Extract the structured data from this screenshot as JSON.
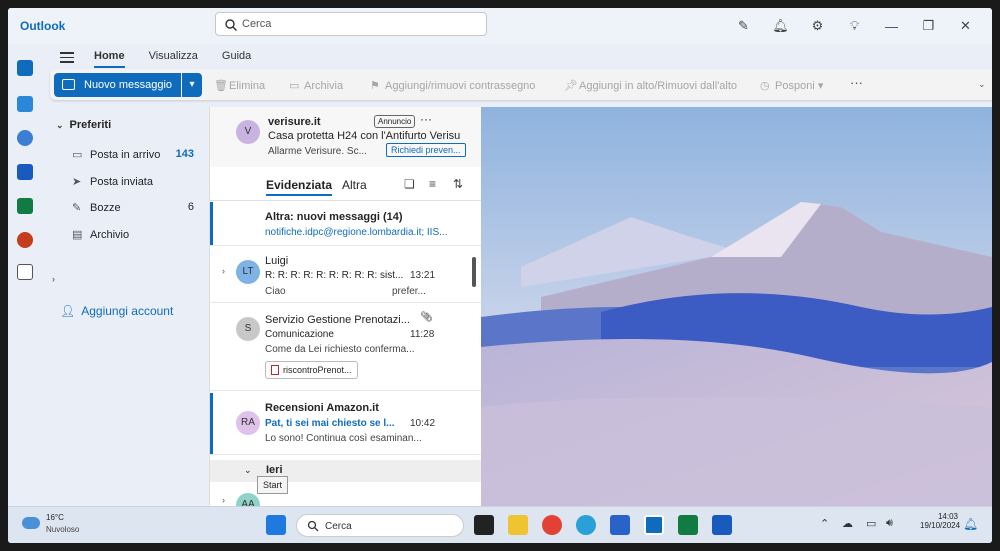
{
  "app": {
    "title": "Outlook"
  },
  "search": {
    "placeholder": "Cerca"
  },
  "titlebar_icons": [
    "compose-note-icon",
    "bell-icon",
    "gear-icon",
    "lightbulb-icon",
    "minimize-icon",
    "restore-icon",
    "close-icon"
  ],
  "tabs": [
    {
      "label": "Home",
      "active": true
    },
    {
      "label": "Visualizza",
      "active": false
    },
    {
      "label": "Guida",
      "active": false
    }
  ],
  "ribbon": {
    "new_message": "Nuovo messaggio",
    "delete": "Elimina",
    "archive": "Archivia",
    "flag": "Aggiungi/rimuovi contrassegno",
    "pin": "Aggiungi in alto/Rimuovi dall'alto",
    "snooze": "Posponi",
    "more": "···"
  },
  "folders": {
    "header": "Preferiti",
    "items": [
      {
        "label": "Posta in arrivo",
        "count": "143",
        "icon": "inbox-icon"
      },
      {
        "label": "Posta inviata",
        "count": "",
        "icon": "send-icon"
      },
      {
        "label": "Bozze",
        "count": "6",
        "icon": "pencil-icon"
      },
      {
        "label": "Archivio",
        "count": "",
        "icon": "archive-icon"
      }
    ],
    "add_account": "Aggiungi account"
  },
  "ad": {
    "avatar": "V",
    "sender": "verisure.it",
    "badge": "Annuncio",
    "subject": "Casa protetta H24 con l'Antifurto Verisu",
    "preview": "Allarme Verisure. Sc...",
    "cta": "Richiedi preven..."
  },
  "list_tabs": {
    "focused": "Evidenziata",
    "other": "Altra"
  },
  "other_banner": {
    "title": "Altra: nuovi messaggi (14)",
    "senders": "notifiche.idpc@regione.lombardia.it; IIS..."
  },
  "messages": [
    {
      "avatar": "LT",
      "from": "Luigi",
      "subject": "R: R: R: R: R: R: R: R: R: sist...",
      "time": "13:21",
      "preview_start": "Ciao",
      "preview_end": "prefer..."
    },
    {
      "avatar": "S",
      "from": "Servizio Gestione Prenotazi...",
      "subject": "Comunicazione",
      "time": "11:28",
      "preview": "Come da Lei richiesto conferma...",
      "attachment": "riscontroPrenot..."
    },
    {
      "avatar": "RA",
      "from": "Recensioni Amazon.it",
      "subject": "Pat, ti sei mai chiesto se l...",
      "time": "10:42",
      "preview": "Lo sono! Continua così esaminan..."
    }
  ],
  "group": {
    "label": "Ieri",
    "next_avatar": "AA"
  },
  "tooltip": "Start",
  "taskbar": {
    "weather_temp": "16°C",
    "weather_desc": "Nuvoloso",
    "search_placeholder": "Cerca",
    "time": "14:03",
    "date": "19/10/2024"
  }
}
